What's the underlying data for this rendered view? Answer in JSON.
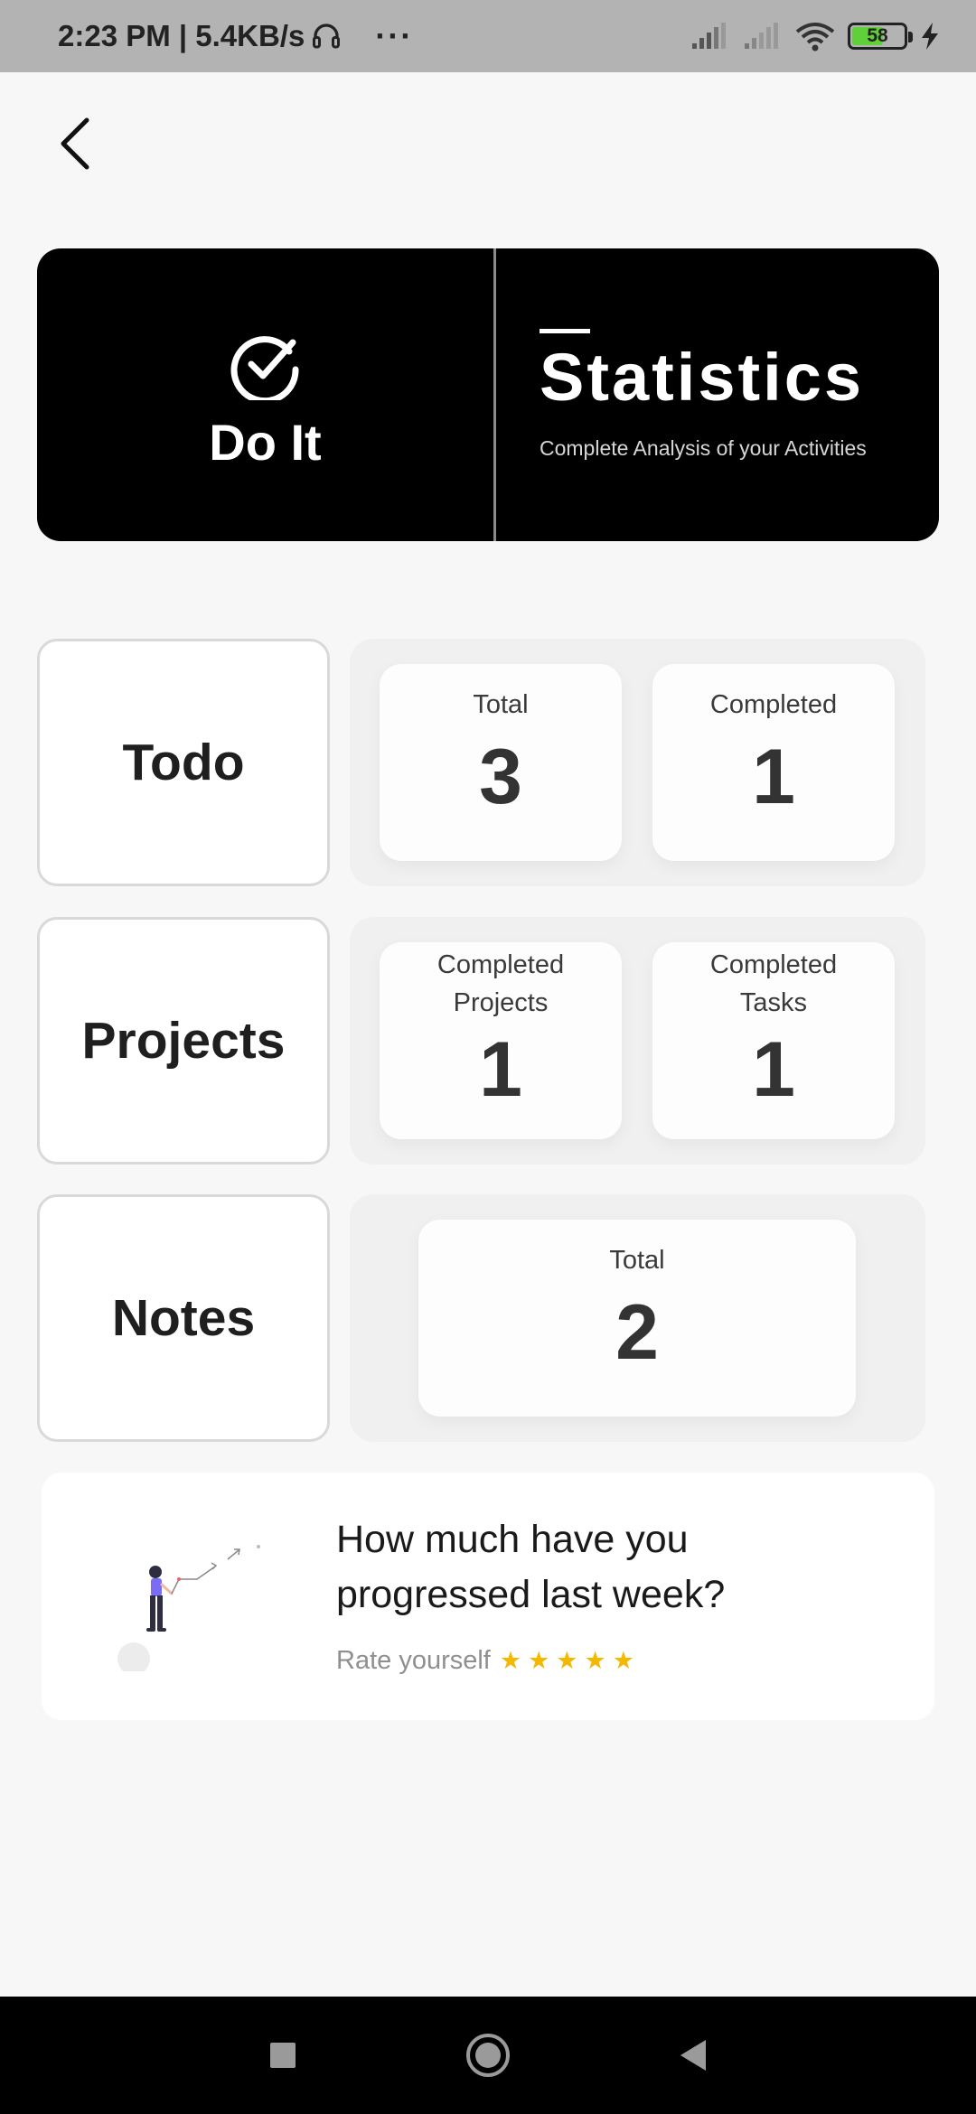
{
  "status_bar": {
    "time_speed": "2:23 PM | 5.4KB/s",
    "more": "···",
    "battery_level": "58"
  },
  "header": {
    "brand_name": "Do It",
    "title": "Statistics",
    "subtitle": "Complete Analysis of your Activities"
  },
  "sections": {
    "todo": {
      "label": "Todo",
      "stats": [
        {
          "label": "Total",
          "value": "3"
        },
        {
          "label": "Completed",
          "value": "1"
        }
      ]
    },
    "projects": {
      "label": "Projects",
      "stats": [
        {
          "label_line1": "Completed",
          "label_line2": "Projects",
          "value": "1"
        },
        {
          "label_line1": "Completed",
          "label_line2": "Tasks",
          "value": "1"
        }
      ]
    },
    "notes": {
      "label": "Notes",
      "stats": [
        {
          "label": "Total",
          "value": "2"
        }
      ]
    }
  },
  "promo": {
    "question": "How much have you progressed last week?",
    "rate_text": "Rate yourself",
    "star": "★",
    "star_count": 5
  },
  "colors": {
    "header_bg": "#000000",
    "star": "#f5b800",
    "battery_fill": "#5fcf3a",
    "illustration_accent": "#7b6cf6"
  },
  "icons": [
    "back-arrow-icon",
    "check-circle-icon",
    "headset-icon",
    "signal-icon",
    "wifi-icon",
    "battery-icon",
    "charging-icon",
    "star-icon",
    "nav-square-icon",
    "nav-circle-icon",
    "nav-triangle-icon"
  ]
}
